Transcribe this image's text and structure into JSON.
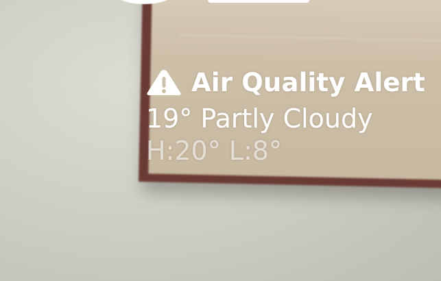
{
  "weather_widget": {
    "alert_icon": "warning-triangle-icon",
    "alert_title": "Air Quality Alert",
    "condition": "19° Partly Cloudy",
    "high_low": "H:20° L:8°"
  }
}
